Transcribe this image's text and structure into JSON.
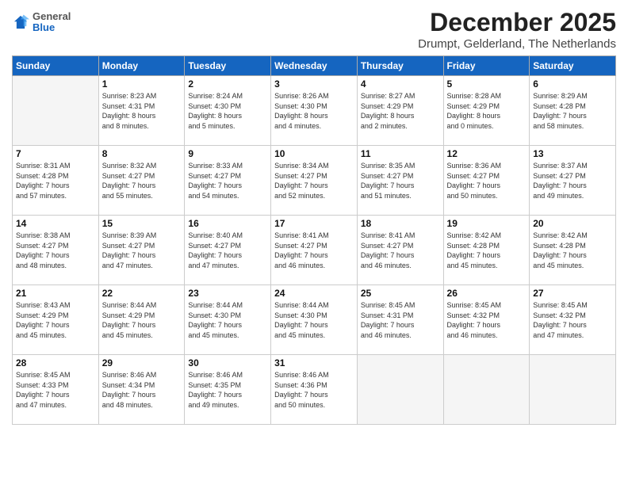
{
  "header": {
    "logo_general": "General",
    "logo_blue": "Blue",
    "month_title": "December 2025",
    "subtitle": "Drumpt, Gelderland, The Netherlands"
  },
  "weekdays": [
    "Sunday",
    "Monday",
    "Tuesday",
    "Wednesday",
    "Thursday",
    "Friday",
    "Saturday"
  ],
  "weeks": [
    [
      {
        "day": "",
        "info": ""
      },
      {
        "day": "1",
        "info": "Sunrise: 8:23 AM\nSunset: 4:31 PM\nDaylight: 8 hours\nand 8 minutes."
      },
      {
        "day": "2",
        "info": "Sunrise: 8:24 AM\nSunset: 4:30 PM\nDaylight: 8 hours\nand 5 minutes."
      },
      {
        "day": "3",
        "info": "Sunrise: 8:26 AM\nSunset: 4:30 PM\nDaylight: 8 hours\nand 4 minutes."
      },
      {
        "day": "4",
        "info": "Sunrise: 8:27 AM\nSunset: 4:29 PM\nDaylight: 8 hours\nand 2 minutes."
      },
      {
        "day": "5",
        "info": "Sunrise: 8:28 AM\nSunset: 4:29 PM\nDaylight: 8 hours\nand 0 minutes."
      },
      {
        "day": "6",
        "info": "Sunrise: 8:29 AM\nSunset: 4:28 PM\nDaylight: 7 hours\nand 58 minutes."
      }
    ],
    [
      {
        "day": "7",
        "info": "Sunrise: 8:31 AM\nSunset: 4:28 PM\nDaylight: 7 hours\nand 57 minutes."
      },
      {
        "day": "8",
        "info": "Sunrise: 8:32 AM\nSunset: 4:27 PM\nDaylight: 7 hours\nand 55 minutes."
      },
      {
        "day": "9",
        "info": "Sunrise: 8:33 AM\nSunset: 4:27 PM\nDaylight: 7 hours\nand 54 minutes."
      },
      {
        "day": "10",
        "info": "Sunrise: 8:34 AM\nSunset: 4:27 PM\nDaylight: 7 hours\nand 52 minutes."
      },
      {
        "day": "11",
        "info": "Sunrise: 8:35 AM\nSunset: 4:27 PM\nDaylight: 7 hours\nand 51 minutes."
      },
      {
        "day": "12",
        "info": "Sunrise: 8:36 AM\nSunset: 4:27 PM\nDaylight: 7 hours\nand 50 minutes."
      },
      {
        "day": "13",
        "info": "Sunrise: 8:37 AM\nSunset: 4:27 PM\nDaylight: 7 hours\nand 49 minutes."
      }
    ],
    [
      {
        "day": "14",
        "info": "Sunrise: 8:38 AM\nSunset: 4:27 PM\nDaylight: 7 hours\nand 48 minutes."
      },
      {
        "day": "15",
        "info": "Sunrise: 8:39 AM\nSunset: 4:27 PM\nDaylight: 7 hours\nand 47 minutes."
      },
      {
        "day": "16",
        "info": "Sunrise: 8:40 AM\nSunset: 4:27 PM\nDaylight: 7 hours\nand 47 minutes."
      },
      {
        "day": "17",
        "info": "Sunrise: 8:41 AM\nSunset: 4:27 PM\nDaylight: 7 hours\nand 46 minutes."
      },
      {
        "day": "18",
        "info": "Sunrise: 8:41 AM\nSunset: 4:27 PM\nDaylight: 7 hours\nand 46 minutes."
      },
      {
        "day": "19",
        "info": "Sunrise: 8:42 AM\nSunset: 4:28 PM\nDaylight: 7 hours\nand 45 minutes."
      },
      {
        "day": "20",
        "info": "Sunrise: 8:42 AM\nSunset: 4:28 PM\nDaylight: 7 hours\nand 45 minutes."
      }
    ],
    [
      {
        "day": "21",
        "info": "Sunrise: 8:43 AM\nSunset: 4:29 PM\nDaylight: 7 hours\nand 45 minutes."
      },
      {
        "day": "22",
        "info": "Sunrise: 8:44 AM\nSunset: 4:29 PM\nDaylight: 7 hours\nand 45 minutes."
      },
      {
        "day": "23",
        "info": "Sunrise: 8:44 AM\nSunset: 4:30 PM\nDaylight: 7 hours\nand 45 minutes."
      },
      {
        "day": "24",
        "info": "Sunrise: 8:44 AM\nSunset: 4:30 PM\nDaylight: 7 hours\nand 45 minutes."
      },
      {
        "day": "25",
        "info": "Sunrise: 8:45 AM\nSunset: 4:31 PM\nDaylight: 7 hours\nand 46 minutes."
      },
      {
        "day": "26",
        "info": "Sunrise: 8:45 AM\nSunset: 4:32 PM\nDaylight: 7 hours\nand 46 minutes."
      },
      {
        "day": "27",
        "info": "Sunrise: 8:45 AM\nSunset: 4:32 PM\nDaylight: 7 hours\nand 47 minutes."
      }
    ],
    [
      {
        "day": "28",
        "info": "Sunrise: 8:45 AM\nSunset: 4:33 PM\nDaylight: 7 hours\nand 47 minutes."
      },
      {
        "day": "29",
        "info": "Sunrise: 8:46 AM\nSunset: 4:34 PM\nDaylight: 7 hours\nand 48 minutes."
      },
      {
        "day": "30",
        "info": "Sunrise: 8:46 AM\nSunset: 4:35 PM\nDaylight: 7 hours\nand 49 minutes."
      },
      {
        "day": "31",
        "info": "Sunrise: 8:46 AM\nSunset: 4:36 PM\nDaylight: 7 hours\nand 50 minutes."
      },
      {
        "day": "",
        "info": ""
      },
      {
        "day": "",
        "info": ""
      },
      {
        "day": "",
        "info": ""
      }
    ]
  ]
}
